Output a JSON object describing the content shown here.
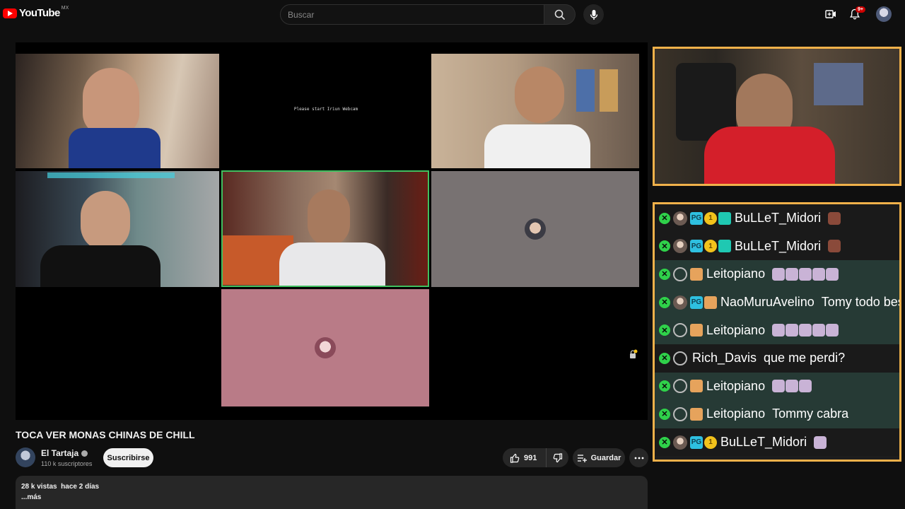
{
  "header": {
    "logo_text": "YouTube",
    "country": "MX",
    "search_placeholder": "Buscar",
    "notification_count": "9+"
  },
  "player": {
    "cams": [
      {
        "id": "cam-1",
        "kind": "video"
      },
      {
        "id": "cam-2",
        "kind": "placeholder",
        "label": "Please start Iriun Webcam"
      },
      {
        "id": "cam-3",
        "kind": "video"
      },
      {
        "id": "cam-4",
        "kind": "video"
      },
      {
        "id": "cam-5",
        "kind": "video",
        "active_speaker": true
      },
      {
        "id": "cam-6",
        "kind": "avatar"
      },
      {
        "id": "cam-7",
        "kind": "avatar"
      }
    ]
  },
  "chat": {
    "messages": [
      {
        "user": "BuLLeT_Midori",
        "badges": [
          "pg",
          "coin",
          "gift"
        ],
        "avatar": "photo",
        "text": "",
        "emotes": 1,
        "emote_style": "brown"
      },
      {
        "user": "BuLLeT_Midori",
        "badges": [
          "pg",
          "coin",
          "gift"
        ],
        "avatar": "photo",
        "text": "",
        "emotes": 1,
        "emote_style": "brown"
      },
      {
        "user": "Leitopiano",
        "badges": [
          "fox"
        ],
        "avatar": "blank",
        "text": "",
        "emotes": 5,
        "emote_style": "pink"
      },
      {
        "user": "NaoMuruAvelino",
        "badges": [
          "pg",
          "fox"
        ],
        "avatar": "photo",
        "text": "Tomy todo bestia",
        "emotes": 0,
        "emote_style": "pink"
      },
      {
        "user": "Leitopiano",
        "badges": [
          "fox"
        ],
        "avatar": "blank",
        "text": "",
        "emotes": 5,
        "emote_style": "pink"
      },
      {
        "user": "Rich_Davis",
        "badges": [],
        "avatar": "blank",
        "text": "que me perdi?",
        "emotes": 0,
        "emote_style": "pink"
      },
      {
        "user": "Leitopiano",
        "badges": [
          "fox"
        ],
        "avatar": "blank",
        "text": "",
        "emotes": 3,
        "emote_style": "pink"
      },
      {
        "user": "Leitopiano",
        "badges": [
          "fox"
        ],
        "avatar": "blank",
        "text": "Tommy cabra",
        "emotes": 0,
        "emote_style": "pink"
      },
      {
        "user": "BuLLeT_Midori",
        "badges": [
          "pg",
          "coin"
        ],
        "avatar": "photo",
        "text": "",
        "emotes": 1,
        "emote_style": "pink"
      }
    ]
  },
  "video": {
    "title": "TOCA VER MONAS CHINAS DE CHILL",
    "channel": "El Tartaja",
    "subscribers": "110 k suscriptores",
    "subscribe_label": "Suscribirse",
    "likes": "991",
    "save_label": "Guardar",
    "views": "28 k vistas",
    "date": "hace 2 días",
    "more_label": "...más"
  },
  "colors": {
    "brand": "#ff0000",
    "frame": "#f0b14a",
    "chat_alt": "#263a35",
    "active_speaker_border": "#3fbf5f"
  }
}
